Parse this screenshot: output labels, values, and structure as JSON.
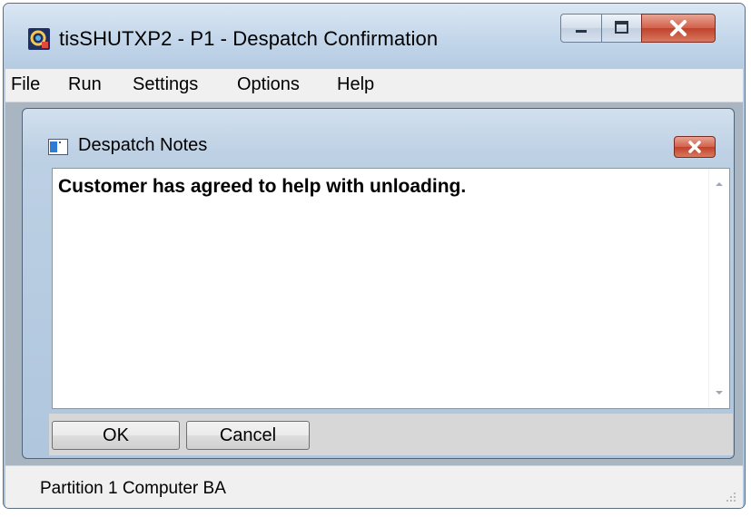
{
  "window": {
    "title": "tisSHUTXP2 - P1 - Despatch Confirmation",
    "app_icon": "app-icon",
    "controls": [
      "minimize-icon",
      "maximize-icon",
      "close-icon"
    ]
  },
  "menu": {
    "items": [
      "File",
      "Run",
      "Settings",
      "Options",
      "Help"
    ]
  },
  "dialog": {
    "title": "Despatch Notes",
    "icon": "notes-window-icon",
    "notes_text": "Customer has agreed to help with unloading.",
    "ok_label": "OK",
    "cancel_label": "Cancel"
  },
  "status": {
    "text": "Partition 1 Computer BA"
  },
  "colors": {
    "title_bar": "#c3d6ea",
    "close_button": "#d2614b",
    "menu_bar": "#f0f0f0",
    "button_strip": "#d7d7d7"
  }
}
